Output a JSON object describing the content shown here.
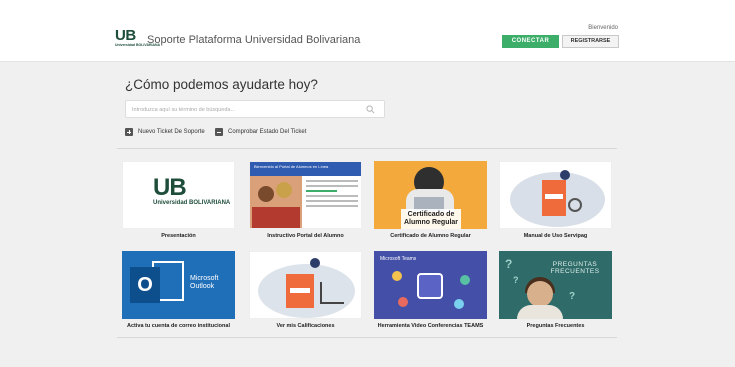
{
  "header": {
    "logo_mark": "UB",
    "logo_sub": "Universidad BOLIVARIANA",
    "site_title": "Soporte Plataforma Universidad Bolivariana",
    "welcome": "Bienvenido",
    "connect_label": "CONECTAR",
    "register_label": "REGISTRARSE"
  },
  "hero": {
    "headline": "¿Cómo podemos ayudarte hoy?",
    "search_placeholder": "Introduzca aquí su término de búsqueda...",
    "actions": [
      {
        "label": "Nuevo Ticket De Soporte"
      },
      {
        "label": "Comprobar Estado Del Ticket"
      }
    ]
  },
  "cards": [
    {
      "label": "Presentación",
      "thumb": {
        "mark": "UB",
        "sub": "Universidad BOLIVARIANA"
      }
    },
    {
      "label": "Instructivo Portal del Alumno",
      "thumb": {
        "header": "Bienvenido al Portal de Alumnos en Línea"
      }
    },
    {
      "label": "Certificado de Alumno Regular",
      "thumb": {
        "caption": "Certificado de Alumno Regular"
      }
    },
    {
      "label": "Manual de Uso Servipag"
    },
    {
      "label": "Activa tu cuenta de correo institucional",
      "thumb": {
        "letter": "O",
        "brand": "Microsoft Outlook"
      }
    },
    {
      "label": "Ver mis Calificaciones"
    },
    {
      "label": "Herramienta Video Conferencias TEAMS",
      "thumb": {
        "header": "Microsoft Teams"
      }
    },
    {
      "label": "Preguntas Frecuentes",
      "thumb": {
        "banner": "PREGUNTAS FRECUENTES"
      }
    }
  ],
  "colors": {
    "brand_green": "#1e4d3a",
    "connect_green": "#3dae69",
    "page_bg": "#f0f0f0"
  }
}
